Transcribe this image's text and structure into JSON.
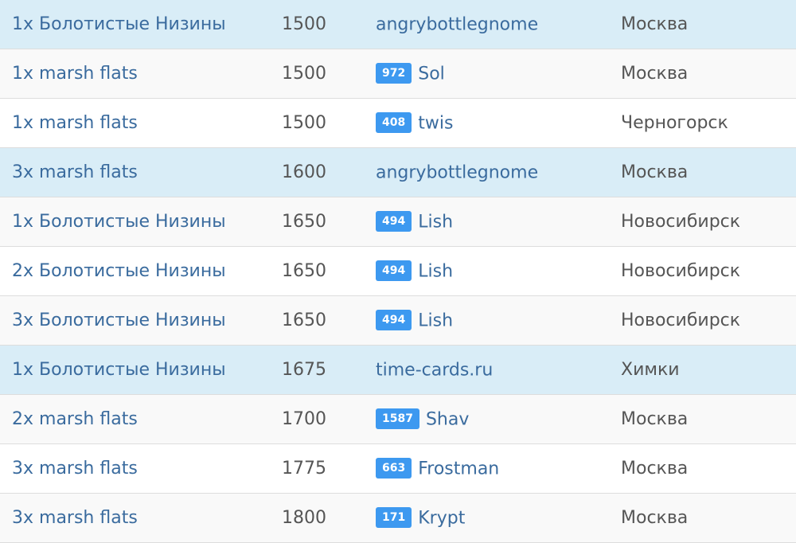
{
  "colors": {
    "link": "#3a6b9e",
    "badge": "#3d99f0",
    "row_highlight": "#d9edf7",
    "row_odd": "#f9f9f9"
  },
  "rows": [
    {
      "style": "hl",
      "card": "1x Болотистые Низины",
      "price": "1500",
      "badge": "",
      "seller": "angrybottlegnome",
      "city": "Москва"
    },
    {
      "style": "odd",
      "card": "1x marsh flats",
      "price": "1500",
      "badge": "972",
      "seller": "Sol",
      "city": "Москва"
    },
    {
      "style": "even",
      "card": "1x marsh flats",
      "price": "1500",
      "badge": "408",
      "seller": "twis",
      "city": "Черногорск"
    },
    {
      "style": "hl",
      "card": "3x marsh flats",
      "price": "1600",
      "badge": "",
      "seller": "angrybottlegnome",
      "city": "Москва"
    },
    {
      "style": "odd",
      "card": "1x Болотистые Низины",
      "price": "1650",
      "badge": "494",
      "seller": "Lish",
      "city": "Новосибирск"
    },
    {
      "style": "even",
      "card": "2x Болотистые Низины",
      "price": "1650",
      "badge": "494",
      "seller": "Lish",
      "city": "Новосибирск"
    },
    {
      "style": "odd",
      "card": "3x Болотистые Низины",
      "price": "1650",
      "badge": "494",
      "seller": "Lish",
      "city": "Новосибирск"
    },
    {
      "style": "hl",
      "card": "1x Болотистые Низины",
      "price": "1675",
      "badge": "",
      "seller": "time-cards.ru",
      "city": "Химки"
    },
    {
      "style": "odd",
      "card": "2x marsh flats",
      "price": "1700",
      "badge": "1587",
      "seller": "Shav",
      "city": "Москва"
    },
    {
      "style": "even",
      "card": "3x marsh flats",
      "price": "1775",
      "badge": "663",
      "seller": "Frostman",
      "city": "Москва"
    },
    {
      "style": "odd",
      "card": "3x marsh flats",
      "price": "1800",
      "badge": "171",
      "seller": "Krypt",
      "city": "Москва"
    }
  ]
}
